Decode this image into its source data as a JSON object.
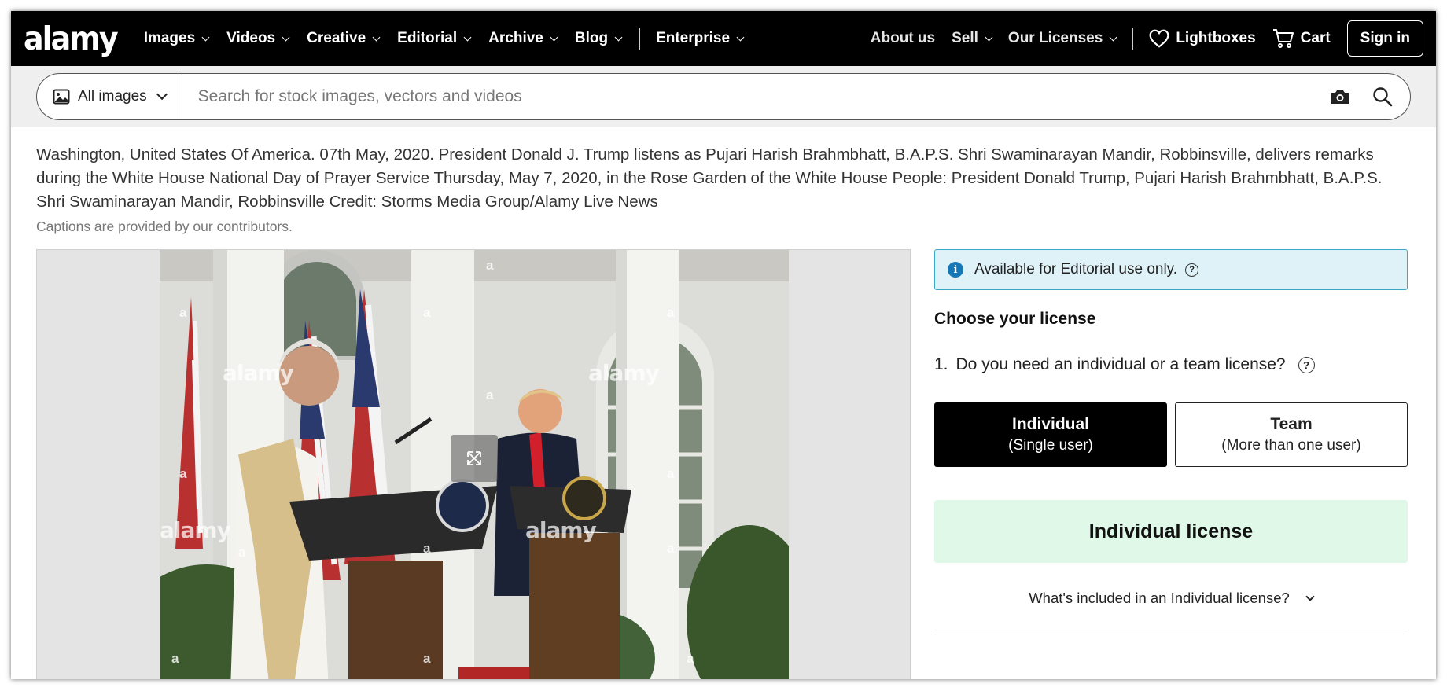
{
  "brand": {
    "logo": "alamy"
  },
  "nav": {
    "left": [
      {
        "label": "Images"
      },
      {
        "label": "Videos"
      },
      {
        "label": "Creative"
      },
      {
        "label": "Editorial"
      },
      {
        "label": "Archive"
      },
      {
        "label": "Blog"
      }
    ],
    "enterprise": "Enterprise",
    "right": [
      {
        "label": "About us"
      },
      {
        "label": "Sell"
      },
      {
        "label": "Our Licenses"
      }
    ],
    "lightboxes": "Lightboxes",
    "cart": "Cart",
    "sign_in": "Sign in"
  },
  "search": {
    "scope": "All images",
    "placeholder": "Search for stock images, vectors and videos",
    "value": ""
  },
  "caption": {
    "text": "Washington, United States Of America. 07th May, 2020. President Donald J. Trump listens as Pujari Harish Brahmbhatt, B.A.P.S. Shri Swaminarayan Mandir, Robbinsville, delivers remarks during the White House National Day of Prayer Service Thursday, May 7, 2020, in the Rose Garden of the White House People: President Donald Trump, Pujari Harish Brahmbhatt, B.A.P.S. Shri Swaminarayan Mandir, Robbinsville Credit: Storms Media Group/Alamy Live News",
    "note": "Captions are provided by our contributors."
  },
  "image": {
    "watermark": "alamy",
    "watermark_letter": "a"
  },
  "license": {
    "notice": "Available for Editorial use only.",
    "choose_title": "Choose your license",
    "question_number": "1.",
    "question": "Do you need an individual or a team license?",
    "options": [
      {
        "title": "Individual",
        "subtitle": "(Single user)",
        "selected": true
      },
      {
        "title": "Team",
        "subtitle": "(More than one user)",
        "selected": false
      }
    ],
    "selected_license": "Individual license",
    "included_link": "What's included in an Individual license?"
  },
  "colors": {
    "nav_bg": "#000000",
    "notice_bg": "#def2f8",
    "notice_border": "#3aa7c4",
    "info_blue": "#1677b7",
    "license_bg": "#dff8e8"
  }
}
